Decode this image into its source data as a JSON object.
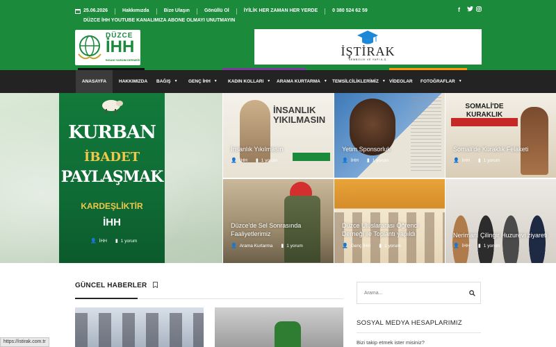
{
  "topbar": {
    "date": "25.06.2026",
    "links": [
      "Hakkımızda",
      "Bize Ulaşın",
      "Gönüllü Ol",
      "İYİLİK HER ZAMAN HER YERDE"
    ],
    "phone": "0 380 524 62 59",
    "announcement": "DÜZCE İHH YOUTUBE KANALIMIZA ABONE OLMAYI UNUTMAYIN",
    "social_icons": [
      "facebook-icon",
      "twitter-icon",
      "instagram-icon"
    ]
  },
  "logo": {
    "top": "DÜZCE",
    "main": "İHH",
    "sub": "İNSANİ YARDIM DERNEĞİ"
  },
  "banner": {
    "title": "İŞTİRAK",
    "subtitle": "SEMBOLİK VE YAPI A.Ş."
  },
  "nav": {
    "items": [
      {
        "label": "ANASAYFA"
      },
      {
        "label": "HAKKIMIZDA"
      },
      {
        "label": "BAĞIŞ"
      },
      {
        "label": "GENÇ İHH"
      },
      {
        "label": "KADIN KOLLARI"
      },
      {
        "label": "ARAMA KURTARMA"
      },
      {
        "label": "TEMSİLCİLİKLERİMİZ"
      },
      {
        "label": "VİDEOLAR"
      },
      {
        "label": "FOTOĞRAFLAR"
      }
    ]
  },
  "featured": {
    "poster": {
      "line1": "KURBAN",
      "line2": "İBADET",
      "line3": "PAYLAŞMAK",
      "line4": "KARDEŞLİKTİR",
      "org": "İHH"
    },
    "main": {
      "category": "İHH",
      "comments": "1 yorum"
    },
    "tiles": [
      {
        "title": "İnsanlık Yıkılmasın",
        "category": "İHH",
        "comments": "1 yorum",
        "poster_text": "İNSANLIK YIKILMASIN"
      },
      {
        "title": "Yetim Sponsorluk",
        "category": "İHH",
        "comments": "1 yorum"
      },
      {
        "title": "Somali'de Kuraklık Felaketi",
        "category": "İHH",
        "comments": "1 yorum",
        "poster_text": "SOMALİ'DE KURAKLIK FELAKETİ!"
      },
      {
        "title": "Düzce'de Sel Sonrasında Faaliyetlerimiz",
        "category": "Arama Kurtarma",
        "comments": "1 yorum"
      },
      {
        "title": "Düzce Uluslararası Öğrenci Derneği ile Toplantı yapıldı",
        "category": "Genç İHH",
        "comments": "1 yorum"
      },
      {
        "title": "Nerimanı Çilingir Huzurevi ziyareti",
        "category": "İHH",
        "comments": "1 yorum"
      }
    ]
  },
  "news_section": {
    "heading": "GÜNCEL HABERLER"
  },
  "sidebar": {
    "search_placeholder": "Arama...",
    "social_heading": "SOSYAL MEDYA HESAPLARIMIZ",
    "social_text": "Bizi takip etmek ister misiniz?"
  },
  "status_bar": {
    "url": "https://istirak.com.tr"
  },
  "colors": {
    "brand_green": "#1b8a3b",
    "nav_dark": "#232323",
    "poster_green": "#0f6b34"
  }
}
